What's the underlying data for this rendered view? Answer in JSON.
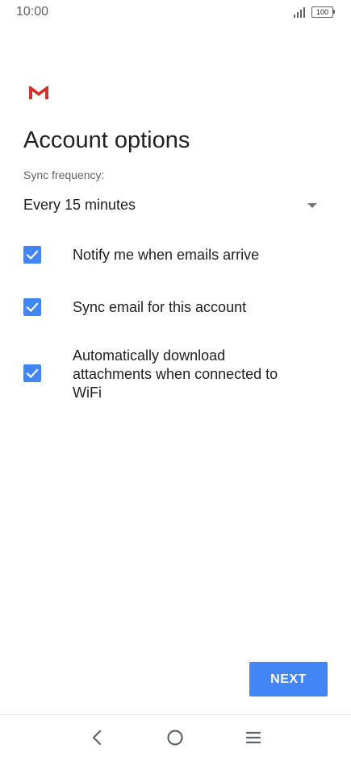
{
  "status_bar": {
    "time": "10:00",
    "battery": "100",
    "icons": [
      "signal-icon",
      "battery-icon"
    ]
  },
  "header": {
    "logo_icon": "gmail-icon",
    "title": "Account options"
  },
  "sync": {
    "label": "Sync frequency:",
    "selected": "Every 15 minutes",
    "icon": "dropdown-arrow-icon"
  },
  "options": [
    {
      "label": "Notify me when emails arrive",
      "checked": true
    },
    {
      "label": "Sync email for this account",
      "checked": true
    },
    {
      "label": "Automatically download attachments when connected to WiFi",
      "checked": true
    }
  ],
  "actions": {
    "next_label": "NEXT"
  },
  "nav_bar": {
    "icons": [
      "back-icon",
      "home-icon",
      "menu-icon"
    ]
  },
  "colors": {
    "accent": "#4285f4",
    "gmail_red": "#d93025",
    "text_primary": "#202124",
    "text_secondary": "#5f6368"
  }
}
